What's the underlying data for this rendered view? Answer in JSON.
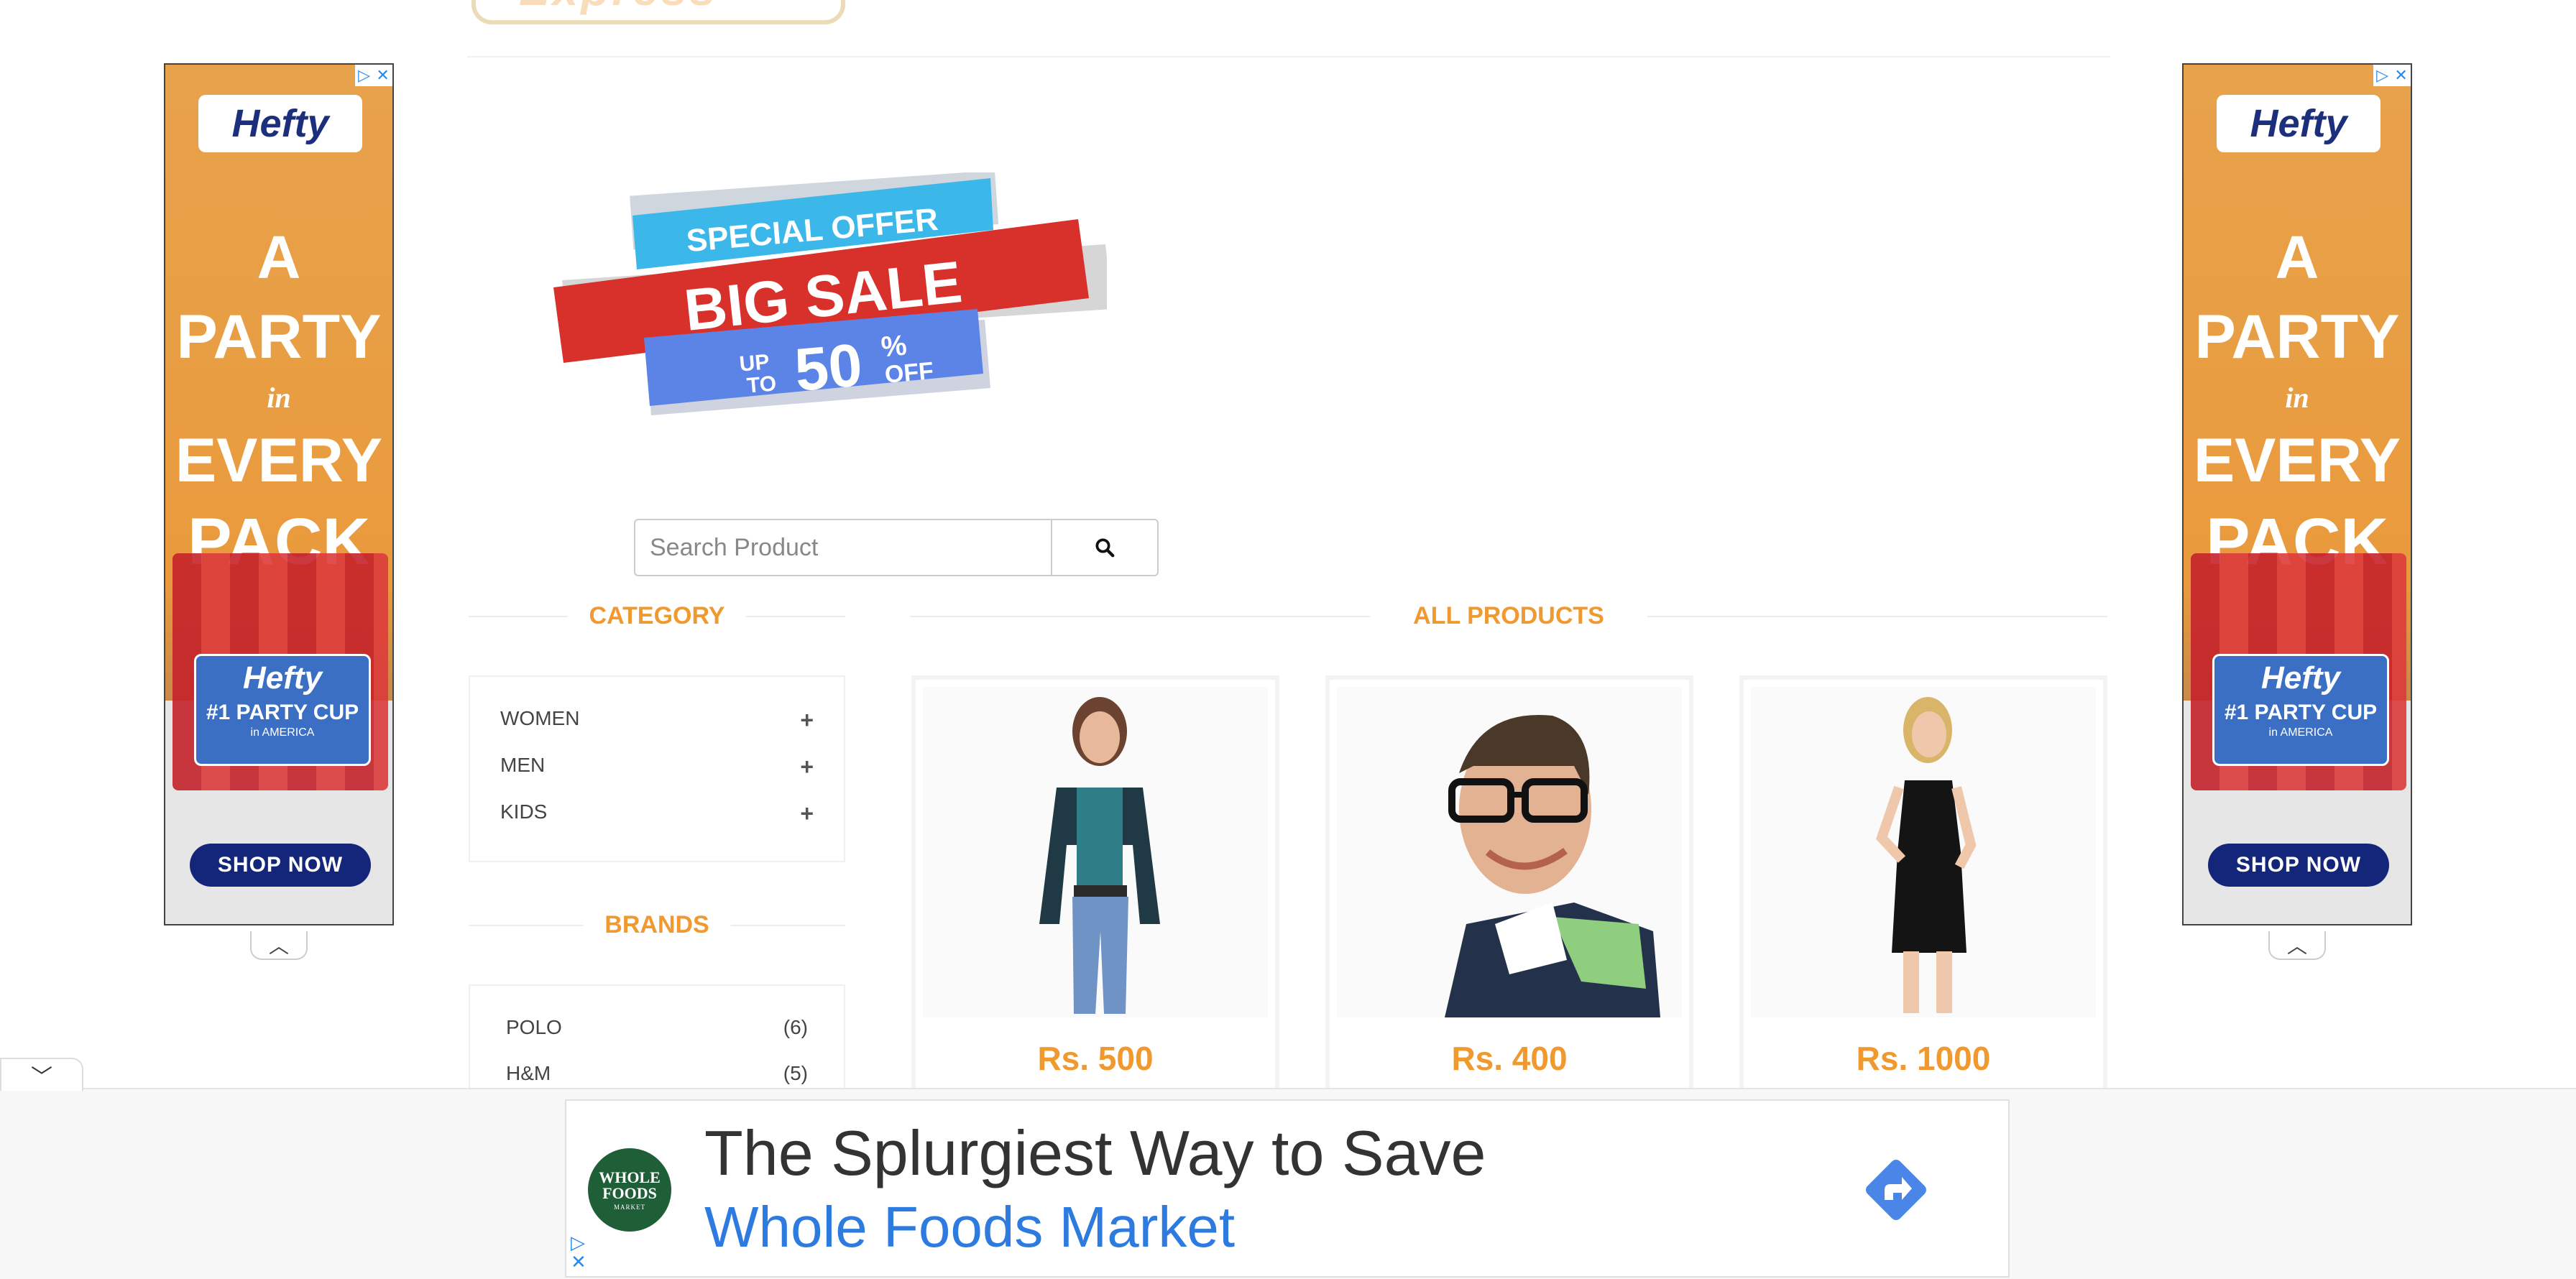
{
  "logo": {
    "text": "Express"
  },
  "ads": {
    "side": {
      "brand": "Hefty",
      "headline": [
        "A",
        "PARTY",
        "in",
        "EVERY",
        "PACK"
      ],
      "cup_brand": "Hefty",
      "cup_tag": "#1 PARTY CUP",
      "cup_sub": "in AMERICA",
      "cta": "SHOP NOW"
    },
    "bottom": {
      "headline": "The Splurgiest Way to Save",
      "advertiser": "Whole Foods Market",
      "logo_lines": [
        "WHOLE",
        "FOODS",
        "MARKET"
      ]
    }
  },
  "banner": {
    "top": "SPECIAL OFFER",
    "middle": "BIG SALE",
    "up_to": [
      "UP",
      "TO"
    ],
    "percent": "50",
    "percent_sign": "%",
    "off": "OFF"
  },
  "search": {
    "placeholder": "Search Product",
    "value": ""
  },
  "category": {
    "title": "CATEGORY",
    "items": [
      {
        "label": "WOMEN",
        "toggle": "+"
      },
      {
        "label": "MEN",
        "toggle": "+"
      },
      {
        "label": "KIDS",
        "toggle": "+"
      }
    ]
  },
  "brands": {
    "title": "BRANDS",
    "items": [
      {
        "label": "POLO",
        "count": "(6)"
      },
      {
        "label": "H&M",
        "count": "(5)"
      }
    ]
  },
  "products": {
    "title": "ALL PRODUCTS",
    "items": [
      {
        "price": "Rs. 500"
      },
      {
        "price": "Rs. 400"
      },
      {
        "price": "Rs. 1000"
      }
    ]
  },
  "colors": {
    "accent": "#f0992f",
    "ad_link": "#2e7be0",
    "ad_navy": "#14267a"
  }
}
